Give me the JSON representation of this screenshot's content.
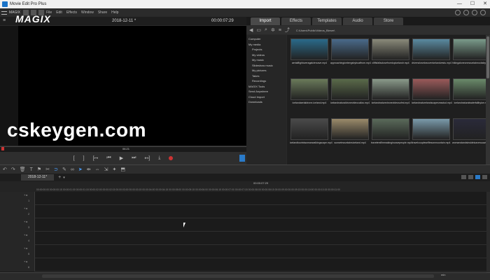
{
  "window": {
    "title": "Movie Edit Pro Plus",
    "controls": [
      "—",
      "☐",
      "✕"
    ]
  },
  "menu": {
    "items": [
      "File",
      "Edit",
      "Effects",
      "Window",
      "Share",
      "Help"
    ],
    "logo": "MAGIX"
  },
  "monitor": {
    "project_title": "2018-12-11 *",
    "timecode": "00:00:07:29",
    "scrub_marker": "06:21",
    "watermark": "cskeygen.com"
  },
  "transport": {
    "buttons": [
      "[",
      "]",
      "[↦",
      "⏮",
      "▶",
      "⏭",
      "↤]",
      "⤓"
    ],
    "record": "record"
  },
  "browser": {
    "tabs": [
      "Import",
      "Effects",
      "Templates",
      "Audio",
      "Store"
    ],
    "active_tab": "Import",
    "path": "C:\\Users\\Public\\Videos_Bieser\\",
    "sidebar": [
      {
        "label": "Computer",
        "sub": false
      },
      {
        "label": "My media",
        "sub": false
      },
      {
        "label": "Projects",
        "sub": true
      },
      {
        "label": "My videos",
        "sub": true
      },
      {
        "label": "My music",
        "sub": true
      },
      {
        "label": "Slideshow music",
        "sub": true
      },
      {
        "label": "My pictures",
        "sub": true
      },
      {
        "label": "Takes",
        "sub": true
      },
      {
        "label": "Recordings",
        "sub": true
      },
      {
        "label": "MAGIX Tools",
        "sub": false
      },
      {
        "label": "Send Anywhere",
        "sub": false
      },
      {
        "label": "Cloud Import",
        "sub": false
      },
      {
        "label": "Downloads",
        "sub": false
      }
    ],
    "files": [
      {
        "name": "aerialflightoveragalciercave.mp4",
        "color": "#2a6a8a"
      },
      {
        "name": "approachingicebergsbyboatfrom.mp4",
        "color": "#4a6a8a"
      },
      {
        "name": "cliffsfallsclosefromtopicelandr.mp4",
        "color": "#8a8a7a"
      },
      {
        "name": "drivencloselowovericelandvestu.mp4",
        "color": "#5a8aa0"
      },
      {
        "name": "hikingaloneonmountainrocksbyia.mp4",
        "color": "#7a9a8a"
      },
      {
        "name": "icelandaerialdrone-iceland.mp4",
        "color": "#6a7a5a"
      },
      {
        "name": "icelandnaturaldronevideocalizo.mp4",
        "color": "#5a6a4a"
      },
      {
        "name": "icelandnaturedronevideosofmi.mp4",
        "color": "#8a9a8a"
      },
      {
        "name": "icelandnaturelandscapesmsstud.mp4",
        "color": "#9a5a5a"
      },
      {
        "name": "icelandnaturalwaterfallbyice.mp4",
        "color": "#6a8a6a"
      },
      {
        "name": "icelandtouristwomanwalkingscape.mp4",
        "color": "#4a4a4a"
      },
      {
        "name": "sunsetmountainsiceland.mp4",
        "color": "#9a8a6a"
      },
      {
        "name": "travelersfilmmakingincavepeople.mp4",
        "color": "#5a6a5a"
      },
      {
        "name": "travelcoupleselfiesonmountain.mp4",
        "color": "#7a9aaa"
      },
      {
        "name": "womanstandsinsideicaveruuaviv.mp4",
        "color": "#2a2a3a"
      }
    ]
  },
  "timeline": {
    "tab_name": "2018-12-11*",
    "center_timecode": "00:00:07:29",
    "ruler": "00:00:00:00  00:00:00:15  00:00:01:00  00:00:01:15  00:00:02:00  00:00:02:15  00:00:03:00  00:00:03:15  00:00:04:00  00:00:04:15  00:00:05:00  00:00:05:15  00:00:06:00  00:00:06:15  00:00:07:00  00:00:07:15  00:00:08:00  00:00:08:15  00:00:09:00  00:00:09:15  00:00:10:00  00:00:10:15  00:00:11:00",
    "tracks": [
      "1",
      "2",
      "3",
      "4",
      "5",
      "6"
    ],
    "zoom": "min"
  }
}
